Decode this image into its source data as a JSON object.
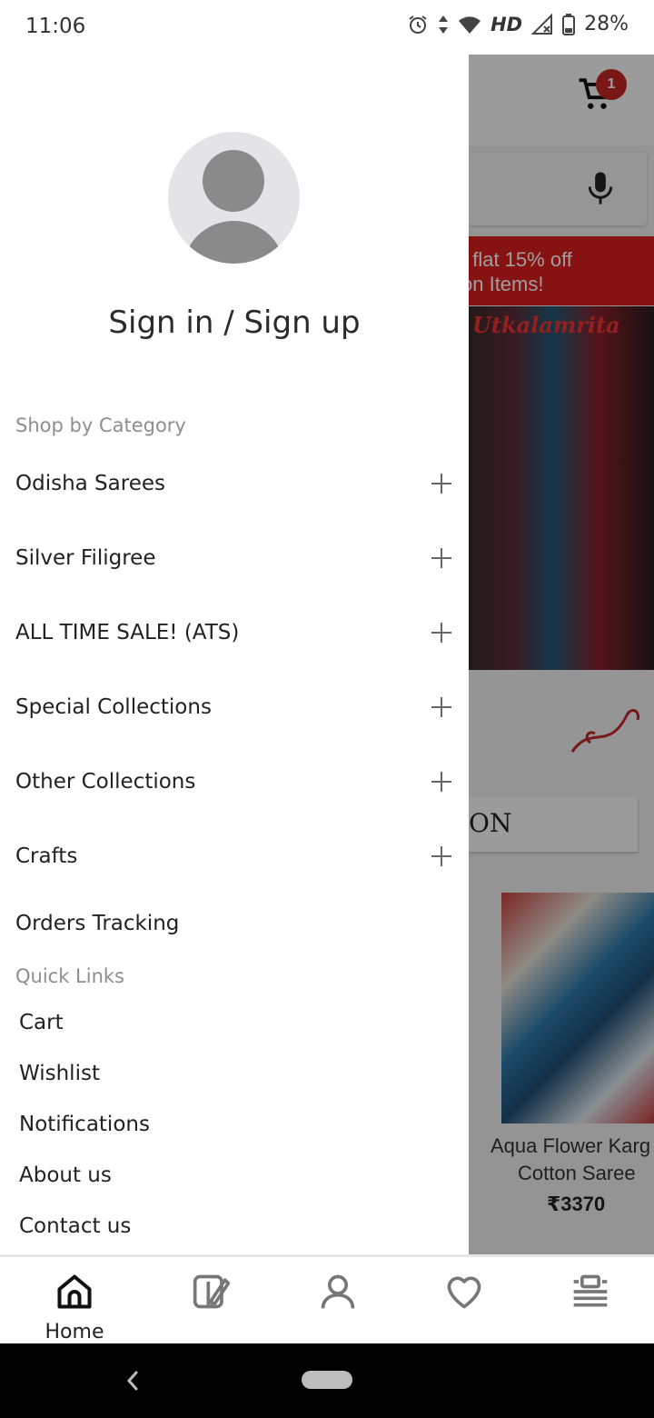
{
  "status_bar": {
    "time": "11:06",
    "network": "HD",
    "battery": "28%",
    "icons": [
      "alarm-icon",
      "data-arrows-icon",
      "wifi-icon",
      "signal-icon",
      "battery-icon"
    ]
  },
  "background": {
    "cart_count": "1",
    "banner_line1": "t flat 15% off",
    "banner_line2": "on Items!",
    "brand_text": "Utkalamrita",
    "heading_fragment": "ON",
    "product_name_line1": "Aqua Flower Karg",
    "product_name_line2": "Cotton Saree",
    "product_price": "₹3370"
  },
  "drawer": {
    "sign_in": "Sign in / Sign up",
    "shop_by_category": "Shop by Category",
    "categories": [
      {
        "label": "Odisha Sarees"
      },
      {
        "label": "Silver Filigree"
      },
      {
        "label": "ALL TIME SALE! (ATS)"
      },
      {
        "label": "Special Collections"
      },
      {
        "label": "Other Collections"
      },
      {
        "label": "Crafts"
      }
    ],
    "orders_tracking": "Orders Tracking",
    "quick_links_label": "Quick Links",
    "quick_links": [
      {
        "label": "Cart"
      },
      {
        "label": "Wishlist"
      },
      {
        "label": "Notifications"
      },
      {
        "label": "About us"
      },
      {
        "label": "Contact us"
      }
    ]
  },
  "bottom_nav": {
    "home_label": "Home",
    "items": [
      "home-icon",
      "catalog-icon",
      "account-icon",
      "wishlist-heart-icon",
      "menu-list-icon"
    ]
  },
  "colors": {
    "accent_red": "#d81e1e",
    "badge_red": "#c62828",
    "drawer_bg": "#ffffff",
    "section_label": "#8e8e8e"
  }
}
